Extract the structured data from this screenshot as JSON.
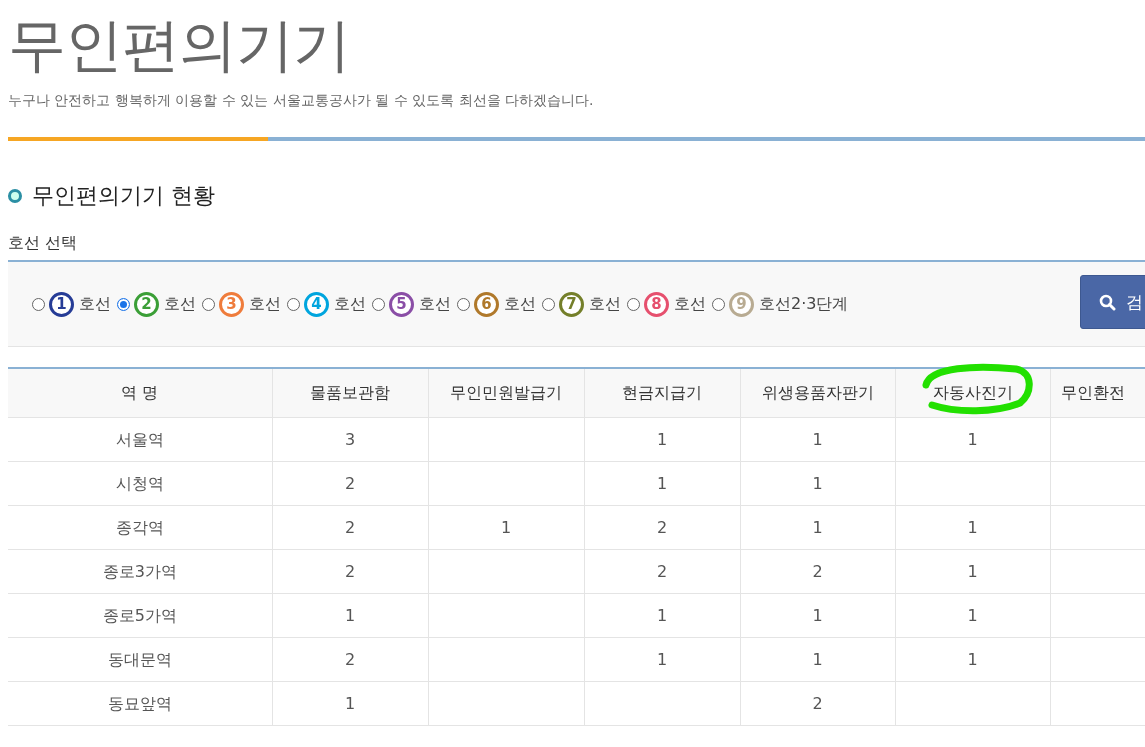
{
  "page": {
    "title": "무인편의기기",
    "subtitle": "누구나 안전하고 행복하게 이용할 수 있는 서울교통공사가 될 수 있도록 최선을 다하겠습니다."
  },
  "section": {
    "heading": "무인편의기기 현황",
    "filter_label": "호선 선택"
  },
  "lines": [
    {
      "number": "1",
      "label": "호선",
      "color": "#263c96",
      "selected": false
    },
    {
      "number": "2",
      "label": "호선",
      "color": "#3b9f37",
      "selected": true
    },
    {
      "number": "3",
      "label": "호선",
      "color": "#ef7c3c",
      "selected": false
    },
    {
      "number": "4",
      "label": "호선",
      "color": "#00a5de",
      "selected": false
    },
    {
      "number": "5",
      "label": "호선",
      "color": "#8a4ea6",
      "selected": false
    },
    {
      "number": "6",
      "label": "호선",
      "color": "#b0792b",
      "selected": false
    },
    {
      "number": "7",
      "label": "호선",
      "color": "#747f2a",
      "selected": false
    },
    {
      "number": "8",
      "label": "호선",
      "color": "#e6506e",
      "selected": false
    },
    {
      "number": "9",
      "label": "호선2·3단계",
      "color": "#b8ab92",
      "selected": false
    }
  ],
  "search_button": {
    "label": "검"
  },
  "table": {
    "columns": [
      {
        "label": "역 명",
        "circled": false
      },
      {
        "label": "물품보관함",
        "circled": false
      },
      {
        "label": "무인민원발급기",
        "circled": false
      },
      {
        "label": "현금지급기",
        "circled": false
      },
      {
        "label": "위생용품자판기",
        "circled": false
      },
      {
        "label": "자동사진기",
        "circled": true
      },
      {
        "label": "무인환전",
        "circled": false
      }
    ],
    "rows": [
      [
        "서울역",
        "3",
        "",
        "1",
        "1",
        "1",
        ""
      ],
      [
        "시청역",
        "2",
        "",
        "1",
        "1",
        "",
        ""
      ],
      [
        "종각역",
        "2",
        "1",
        "2",
        "1",
        "1",
        ""
      ],
      [
        "종로3가역",
        "2",
        "",
        "2",
        "2",
        "1",
        ""
      ],
      [
        "종로5가역",
        "1",
        "",
        "1",
        "1",
        "1",
        ""
      ],
      [
        "동대문역",
        "2",
        "",
        "1",
        "1",
        "1",
        ""
      ],
      [
        "동묘앞역",
        "1",
        "",
        "",
        "2",
        "",
        ""
      ]
    ]
  }
}
